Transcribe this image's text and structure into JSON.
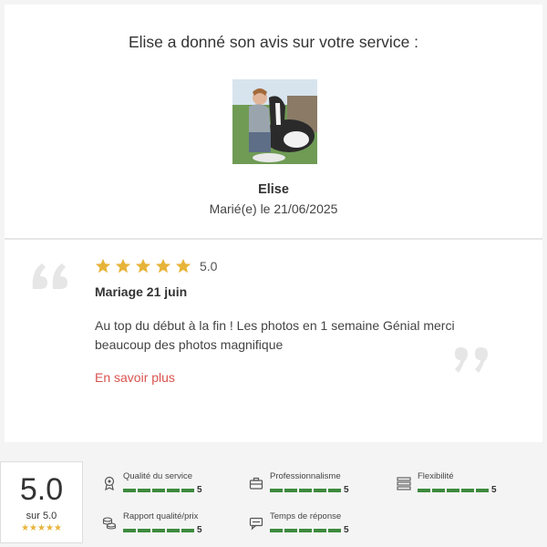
{
  "heading": "Elise a donné son avis sur votre service :",
  "reviewer": {
    "name": "Elise",
    "married": "Marié(e) le 21/06/2025"
  },
  "review": {
    "rating": "5.0",
    "rating_value": 5,
    "title": "Mariage 21 juin",
    "text": "Au top du début à la fin ! Les photos en 1 semaine Génial merci beaucoup des photos magnifique",
    "more_link": "En savoir plus"
  },
  "summary": {
    "score": "5.0",
    "out_of": "sur 5.0",
    "stars": "★★★★★"
  },
  "criteria": [
    {
      "label": "Qualité du service",
      "value": "5",
      "icon": "award-icon"
    },
    {
      "label": "Professionnalisme",
      "value": "5",
      "icon": "briefcase-icon"
    },
    {
      "label": "Flexibilité",
      "value": "5",
      "icon": "sliders-icon"
    },
    {
      "label": "Rapport qualité/prix",
      "value": "5",
      "icon": "coins-icon"
    },
    {
      "label": "Temps de réponse",
      "value": "5",
      "icon": "chat-icon"
    }
  ],
  "colors": {
    "star": "#e7b43a",
    "bar": "#3d8a3d",
    "link": "#d9534f"
  }
}
